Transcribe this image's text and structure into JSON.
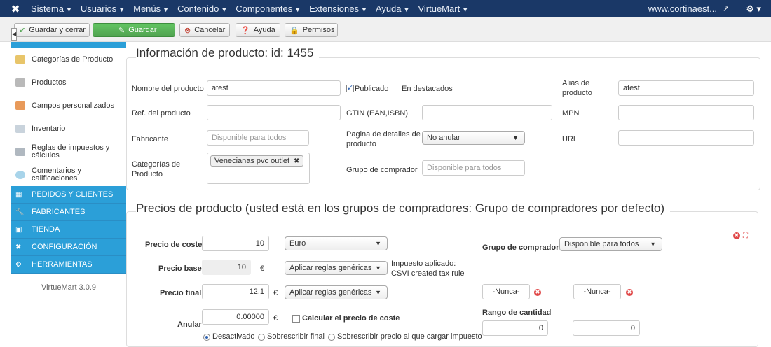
{
  "navbar": {
    "menu": [
      "Sistema",
      "Usuarios",
      "Menús",
      "Contenido",
      "Componentes",
      "Extensiones",
      "Ayuda",
      "VirtueMart"
    ],
    "site": "www.cortinaest..."
  },
  "toolbar": {
    "save_close": "Guardar y cerrar",
    "save": "Guardar",
    "cancel": "Cancelar",
    "help": "Ayuda",
    "permissions": "Permisos"
  },
  "sidebar": {
    "items": [
      {
        "label": "Categorías de Producto"
      },
      {
        "label": "Productos"
      },
      {
        "label": "Campos personalizados"
      },
      {
        "label": "Inventario"
      },
      {
        "label": "Reglas de impuestos y cálculos"
      },
      {
        "label": "Comentarios y calificaciones"
      }
    ],
    "sections": [
      "PEDIDOS Y CLIENTES",
      "FABRICANTES",
      "TIENDA",
      "CONFIGURACIÓN",
      "HERRAMIENTAS"
    ],
    "version": "VirtueMart 3.0.9"
  },
  "product_info": {
    "title": "Información de producto: id: 1455",
    "name_label": "Nombre del producto",
    "name_value": "atest",
    "published_label": "Publicado",
    "featured_label": "En destacados",
    "alias_label": "Alias de producto",
    "alias_value": "atest",
    "ref_label": "Ref. del producto",
    "gtin_label": "GTIN (EAN,ISBN)",
    "mpn_label": "MPN",
    "manufacturer_label": "Fabricante",
    "manufacturer_placeholder": "Disponible para todos",
    "detail_page_label": "Pagina de detalles de producto",
    "detail_page_value": "No anular",
    "url_label": "URL",
    "categories_label": "Categorías de Producto",
    "category_tag": "Venecianas pvc outlet",
    "shopper_group_label": "Grupo de comprador",
    "shopper_group_placeholder": "Disponible para todos"
  },
  "prices": {
    "title": "Precios de producto (usted está en los grupos de compradores: Grupo de compradores por defecto)",
    "cost_label": "Precio de coste",
    "cost_value": "10",
    "currency": "Euro",
    "base_label": "Precio base",
    "base_value": "10",
    "euro_symbol": "€",
    "rules_1": "Aplicar reglas genéricas",
    "tax_applied_1": "Impuesto aplicado:",
    "tax_applied_2": "CSVI created tax rule",
    "final_label": "Precio final",
    "final_value": "12.1",
    "rules_2": "Aplicar reglas genéricas",
    "override_label": "Anular",
    "override_value": "0.00000",
    "calc_cost_label": "Calcular el precio de coste",
    "radio_disabled": "Desactivado",
    "radio_overwrite_final": "Sobrescribir final",
    "radio_overwrite_tax": "Sobrescribir precio al que cargar impuesto",
    "shopper_group_label": "Grupo de comprador",
    "shopper_group_value": "Disponible para todos",
    "never_1": "-Nunca-",
    "never_2": "-Nunca-",
    "qty_range_label": "Rango de cantidad",
    "qty_from": "0",
    "qty_to": "0"
  },
  "colors": {
    "navbar": "#1a3867",
    "sidebar_section": "#2b9fd8",
    "save_green": "#51a351"
  }
}
